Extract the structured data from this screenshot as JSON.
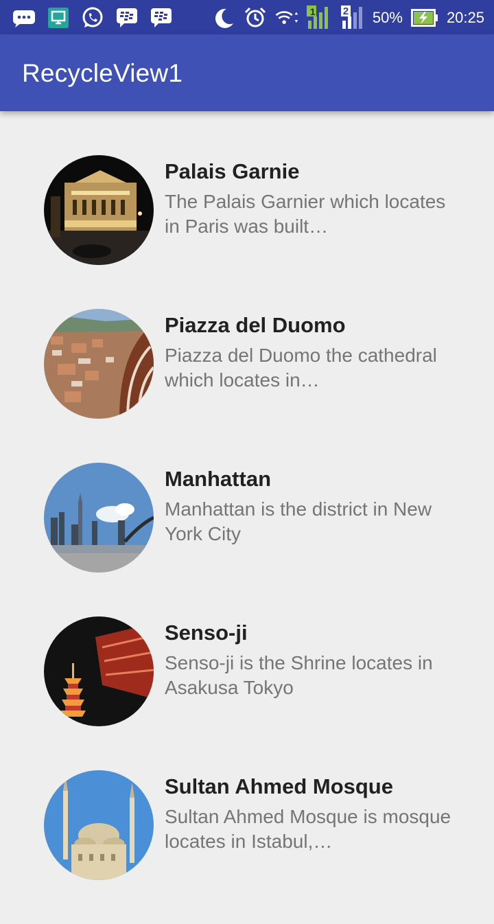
{
  "status_bar": {
    "battery_percent": "50%",
    "time": "20:25",
    "sim1_label": "1",
    "sim2_label": "2",
    "icons": [
      "message-icon",
      "screen-share-icon",
      "whatsapp-icon",
      "bbm-icon",
      "bbm-icon",
      "moon-icon",
      "alarm-icon",
      "wifi-icon",
      "signal-icon",
      "signal-icon",
      "battery-charging-icon"
    ]
  },
  "app_bar": {
    "title": "RecycleView1",
    "color": "#3f51b5",
    "status_color": "#303f9f"
  },
  "items": [
    {
      "title": "Palais Garnie",
      "description": "The Palais Garnier which locates in Paris was built…",
      "image": "palais-garnier-photo"
    },
    {
      "title": "Piazza del Duomo",
      "description": "Piazza del Duomo the cathedral which locates in…",
      "image": "piazza-del-duomo-photo"
    },
    {
      "title": "Manhattan",
      "description": "Manhattan is the district in New York City",
      "image": "manhattan-photo"
    },
    {
      "title": "Senso-ji",
      "description": "Senso-ji is the Shrine locates in Asakusa Tokyo",
      "image": "senso-ji-photo"
    },
    {
      "title": "Sultan Ahmed Mosque",
      "description": "Sultan Ahmed Mosque is mosque locates in Istabul,…",
      "image": "sultan-ahmed-mosque-photo"
    }
  ]
}
